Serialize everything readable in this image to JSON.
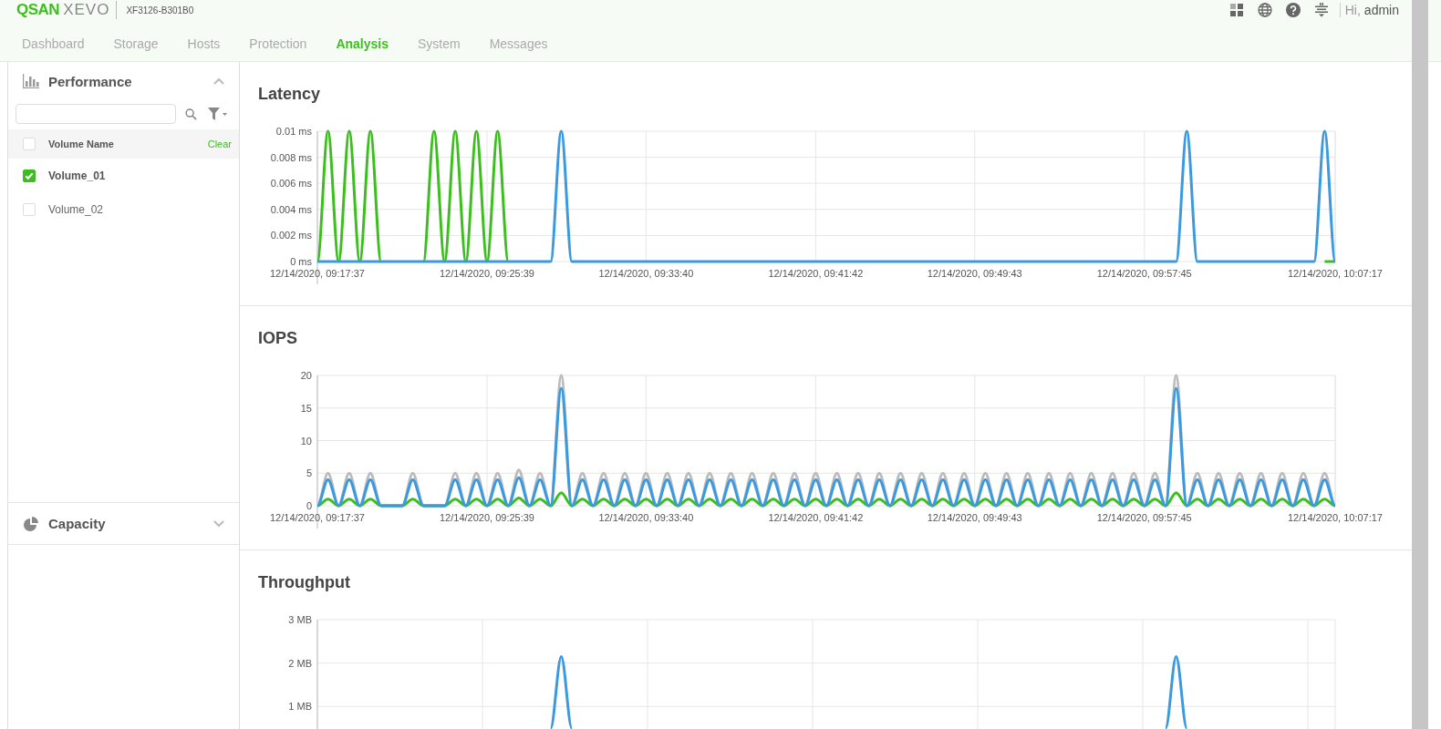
{
  "header": {
    "logo_primary": "QSAN",
    "logo_secondary": "XEVO",
    "model": "XF3126-B301B0",
    "greeting": "Hi,",
    "user": "admin"
  },
  "tabs": [
    {
      "label": "Dashboard",
      "selected": false
    },
    {
      "label": "Storage",
      "selected": false
    },
    {
      "label": "Hosts",
      "selected": false
    },
    {
      "label": "Protection",
      "selected": false
    },
    {
      "label": "Analysis",
      "selected": true
    },
    {
      "label": "System",
      "selected": false
    },
    {
      "label": "Messages",
      "selected": false
    }
  ],
  "sidebar": {
    "panels": [
      {
        "title": "Performance",
        "expanded": true,
        "kind": "performance"
      },
      {
        "title": "Capacity",
        "expanded": false,
        "kind": "capacity"
      }
    ],
    "volume_table": {
      "header": {
        "label": "Volume Name",
        "checked": false,
        "action": "Clear"
      },
      "rows": [
        {
          "name": "Volume_01",
          "checked": true
        },
        {
          "name": "Volume_02",
          "checked": false
        }
      ]
    }
  },
  "sections": [
    {
      "title": "Latency",
      "chart_data": {
        "type": "line",
        "categories": [
          "12/14/2020, 09:17:37",
          null,
          null,
          null,
          null,
          null,
          null,
          null,
          null,
          null,
          null,
          null,
          null,
          null,
          null,
          null,
          "12/14/2020, 09:25:39",
          null,
          null,
          null,
          null,
          null,
          null,
          null,
          null,
          null,
          null,
          null,
          null,
          null,
          null,
          "12/14/2020, 09:33:40",
          null,
          null,
          null,
          null,
          null,
          null,
          null,
          null,
          null,
          null,
          null,
          null,
          null,
          null,
          null,
          "12/14/2020, 09:41:42",
          null,
          null,
          null,
          null,
          null,
          null,
          null,
          null,
          null,
          null,
          null,
          null,
          null,
          null,
          "12/14/2020, 09:49:43",
          null,
          null,
          null,
          null,
          null,
          null,
          null,
          null,
          null,
          null,
          null,
          null,
          null,
          null,
          null,
          "12/14/2020, 09:57:45",
          null,
          null,
          null,
          null,
          null,
          null,
          null,
          null,
          null,
          null,
          null,
          null,
          null,
          null,
          null,
          null,
          null,
          "12/14/2020, 10:07:17"
        ],
        "ylim": [
          0,
          0.01
        ],
        "grid": true,
        "yticks": [
          {
            "value": 0,
            "label": "0 ms"
          },
          {
            "value": 0.002,
            "label": "0.002 ms"
          },
          {
            "value": 0.004,
            "label": "0.004 ms"
          },
          {
            "value": 0.006,
            "label": "0.006 ms"
          },
          {
            "value": 0.008,
            "label": "0.008 ms"
          },
          {
            "value": 0.01,
            "label": "0.01 ms"
          }
        ],
        "series": [
          {
            "color": "#3cbf1e",
            "values": [
              0,
              0.01,
              0,
              0.01,
              0,
              0.01,
              0,
              null,
              null,
              null,
              0,
              0.01,
              0,
              0.01,
              0,
              0.01,
              0,
              0.01,
              0,
              null,
              null,
              null,
              null,
              null,
              null,
              null,
              null,
              null,
              null,
              null,
              null,
              null,
              null,
              null,
              null,
              null,
              null,
              null,
              null,
              null,
              null,
              null,
              null,
              null,
              null,
              null,
              null,
              null,
              null,
              null,
              null,
              null,
              null,
              null,
              null,
              null,
              null,
              null,
              null,
              null,
              null,
              null,
              null,
              null,
              null,
              null,
              null,
              null,
              null,
              null,
              null,
              null,
              null,
              null,
              null,
              null,
              null,
              null,
              null,
              null,
              null,
              null,
              null,
              null,
              null,
              null,
              null,
              null,
              null,
              null,
              null,
              null,
              null,
              null,
              null,
              0,
              0
            ]
          },
          {
            "color": "#3b99e0",
            "values": [
              0,
              0,
              0,
              0,
              0,
              0,
              0,
              0,
              0,
              0,
              0,
              0,
              0,
              0,
              0,
              0,
              0,
              0,
              0,
              0,
              0,
              0,
              0,
              0.01,
              0,
              0,
              0,
              0,
              0,
              0,
              0,
              0,
              0,
              0,
              0,
              0,
              0,
              0,
              0,
              0,
              0,
              0,
              0,
              0,
              0,
              0,
              0,
              0,
              0,
              0,
              0,
              0,
              0,
              0,
              0,
              0,
              0,
              0,
              0,
              0,
              0,
              0,
              0,
              0,
              0,
              0,
              0,
              0,
              0,
              0,
              0,
              0,
              0,
              0,
              0,
              0,
              0,
              0,
              0,
              0,
              0,
              0,
              0.01,
              0,
              0,
              0,
              0,
              0,
              0,
              0,
              0,
              0,
              0,
              0,
              0,
              0.01,
              0
            ]
          }
        ]
      }
    },
    {
      "title": "IOPS",
      "chart_data": {
        "type": "line",
        "categories": [
          "12/14/2020, 09:17:37",
          null,
          null,
          null,
          null,
          null,
          null,
          null,
          null,
          null,
          null,
          null,
          null,
          null,
          null,
          null,
          "12/14/2020, 09:25:39",
          null,
          null,
          null,
          null,
          null,
          null,
          null,
          null,
          null,
          null,
          null,
          null,
          null,
          null,
          "12/14/2020, 09:33:40",
          null,
          null,
          null,
          null,
          null,
          null,
          null,
          null,
          null,
          null,
          null,
          null,
          null,
          null,
          null,
          "12/14/2020, 09:41:42",
          null,
          null,
          null,
          null,
          null,
          null,
          null,
          null,
          null,
          null,
          null,
          null,
          null,
          null,
          "12/14/2020, 09:49:43",
          null,
          null,
          null,
          null,
          null,
          null,
          null,
          null,
          null,
          null,
          null,
          null,
          null,
          null,
          null,
          "12/14/2020, 09:57:45",
          null,
          null,
          null,
          null,
          null,
          null,
          null,
          null,
          null,
          null,
          null,
          null,
          null,
          null,
          null,
          null,
          null,
          "12/14/2020, 10:07:17"
        ],
        "ylim": [
          0,
          20
        ],
        "grid": true,
        "yticks": [
          {
            "value": 0,
            "label": "0"
          },
          {
            "value": 5,
            "label": "5"
          },
          {
            "value": 10,
            "label": "10"
          },
          {
            "value": 15,
            "label": "15"
          },
          {
            "value": 20,
            "label": "20"
          }
        ],
        "series": [
          {
            "color": "#bbbbbb",
            "values": [
              0,
              5,
              0,
              5,
              0,
              5,
              0,
              0,
              0,
              5,
              0,
              0,
              0,
              5,
              0,
              5,
              0,
              5,
              0,
              5.5,
              0,
              5,
              0,
              20,
              0,
              5,
              0,
              5,
              0,
              5,
              0,
              5,
              0,
              5,
              0,
              5,
              0,
              5,
              0,
              5,
              0,
              5,
              0,
              5,
              0,
              5,
              0,
              5,
              0,
              5,
              0,
              5,
              0,
              5,
              0,
              5,
              0,
              5,
              0,
              5,
              0,
              5,
              0,
              5,
              0,
              5,
              0,
              5,
              0,
              5,
              0,
              5,
              0,
              5,
              0,
              5,
              0,
              5,
              0,
              5,
              0,
              20,
              0,
              5,
              0,
              5,
              0,
              5,
              0,
              5,
              0,
              5,
              0,
              5,
              0,
              5,
              0
            ]
          },
          {
            "color": "#3cbf1e",
            "values": [
              0,
              1,
              0,
              1,
              0,
              1,
              0,
              0,
              0,
              1,
              0,
              0,
              0,
              1,
              0,
              1,
              0,
              1,
              0,
              1.2,
              0,
              1,
              0,
              2,
              0,
              1,
              0,
              1,
              0,
              1,
              0,
              1,
              0,
              1,
              0,
              1,
              0,
              1,
              0,
              1,
              0,
              1,
              0,
              1,
              0,
              1,
              0,
              1,
              0,
              1,
              0,
              1,
              0,
              1,
              0,
              1,
              0,
              1,
              0,
              1,
              0,
              1,
              0,
              1,
              0,
              1,
              0,
              1,
              0,
              1,
              0,
              1,
              0,
              1,
              0,
              1,
              0,
              1,
              0,
              1,
              0,
              2,
              0,
              1,
              0,
              1,
              0,
              1,
              0,
              1,
              0,
              1,
              0,
              1,
              0,
              1,
              0
            ]
          },
          {
            "color": "#3b99e0",
            "values": [
              0,
              4,
              0,
              4,
              0,
              4,
              0,
              0,
              0,
              4,
              0,
              0,
              0,
              4,
              0,
              4,
              0,
              4,
              0,
              4.3,
              0,
              4,
              0,
              18,
              0,
              4,
              0,
              4,
              0,
              4,
              0,
              4,
              0,
              4,
              0,
              4,
              0,
              4,
              0,
              4,
              0,
              4,
              0,
              4,
              0,
              4,
              0,
              4,
              0,
              4,
              0,
              4,
              0,
              4,
              0,
              4,
              0,
              4,
              0,
              4,
              0,
              4,
              0,
              4,
              0,
              4,
              0,
              4,
              0,
              4,
              0,
              4,
              0,
              4,
              0,
              4,
              0,
              4,
              0,
              4,
              0,
              18,
              0,
              4,
              0,
              4,
              0,
              4,
              0,
              4,
              0,
              4,
              0,
              4,
              0,
              4,
              0
            ]
          }
        ]
      }
    },
    {
      "title": "Throughput",
      "chart_data": {
        "type": "line",
        "ylim": [
          0,
          3
        ],
        "grid": true,
        "yticks": [
          {
            "value": 1,
            "label": "1 MB"
          },
          {
            "value": 2,
            "label": "2 MB"
          },
          {
            "value": 3,
            "label": "3 MB"
          }
        ],
        "series": [
          {
            "color": "#3b99e0",
            "values": [
              null,
              null,
              null,
              null,
              null,
              null,
              null,
              null,
              null,
              null,
              null,
              null,
              null,
              null,
              null,
              null,
              null,
              null,
              null,
              null,
              null,
              null,
              0.5,
              2.15,
              0.5,
              null,
              null,
              null,
              null,
              null,
              null,
              null,
              null,
              null,
              null,
              null,
              null,
              null,
              null,
              null,
              null,
              null,
              null,
              null,
              null,
              null,
              null,
              null,
              null,
              null,
              null,
              null,
              null,
              null,
              null,
              null,
              null,
              null,
              null,
              null,
              null,
              null,
              null,
              null,
              null,
              null,
              null,
              null,
              null,
              null,
              null,
              null,
              null,
              null,
              null,
              null,
              null,
              null,
              null,
              null,
              0.5,
              2.15,
              0.5,
              null,
              null,
              null,
              null,
              null,
              null,
              null,
              null,
              null,
              null,
              null,
              null,
              null,
              null
            ]
          }
        ]
      }
    }
  ]
}
